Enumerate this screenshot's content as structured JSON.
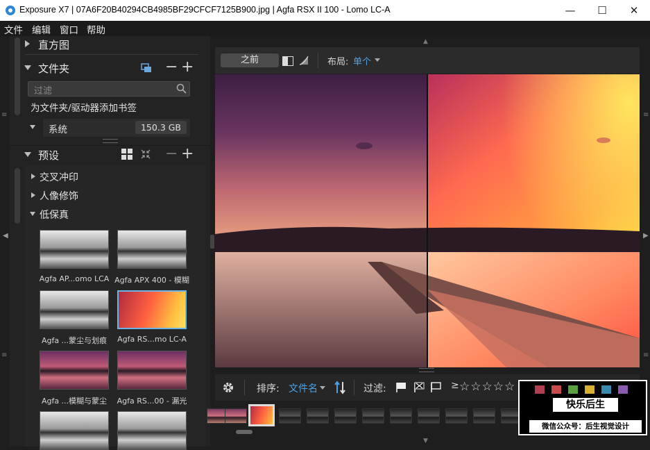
{
  "window": {
    "title": "Exposure X7 | 07A6F20B40294CB4985BF29CFCF7125B900.jpg | Agfa RSX II 100 - Lomo LC-A",
    "minimize": "—",
    "maximize": "☐",
    "close": "✕"
  },
  "menu": [
    "文件",
    "编辑",
    "窗口",
    "帮助"
  ],
  "left": {
    "histogram": "直方图",
    "folders": "文件夹",
    "filter_placeholder": "过滤",
    "bookmark_hint": "为文件夹/驱动器添加书签",
    "drive_name": "系统",
    "drive_size": "150.3 GB",
    "presets": "预设",
    "categories": [
      "交叉冲印",
      "人像修饰",
      "低保真"
    ],
    "thumbs": [
      {
        "label": "Agfa AP...omo LCA",
        "style": "bw"
      },
      {
        "label": "Agfa APX 400 - 模糊",
        "style": "bw"
      },
      {
        "label": "Agfa ...蒙尘与划痕",
        "style": "bw"
      },
      {
        "label": "Agfa RS...mo LC-A",
        "style": "warm"
      },
      {
        "label": "Agfa ...模糊与蒙尘",
        "style": "color"
      },
      {
        "label": "Agfa RS...00 - 漏光",
        "style": "color"
      },
      {
        "label": "",
        "style": "bw"
      },
      {
        "label": "",
        "style": "bw"
      }
    ]
  },
  "toolbar": {
    "before": "之前",
    "layout_label": "布局:",
    "layout_value": "单个"
  },
  "bottom": {
    "sort_label": "排序:",
    "sort_value": "文件名",
    "filter_label": "过滤:",
    "rating_prefix": "≥",
    "stars": "☆☆☆☆☆"
  },
  "watermark": {
    "title": "快乐后生",
    "subtitle": "微信公众号：后生视觉设计",
    "swatches": [
      "#b04050",
      "#c84a4a",
      "#5aa040",
      "#d8b030",
      "#3a8ab0",
      "#8a5ab0"
    ]
  }
}
